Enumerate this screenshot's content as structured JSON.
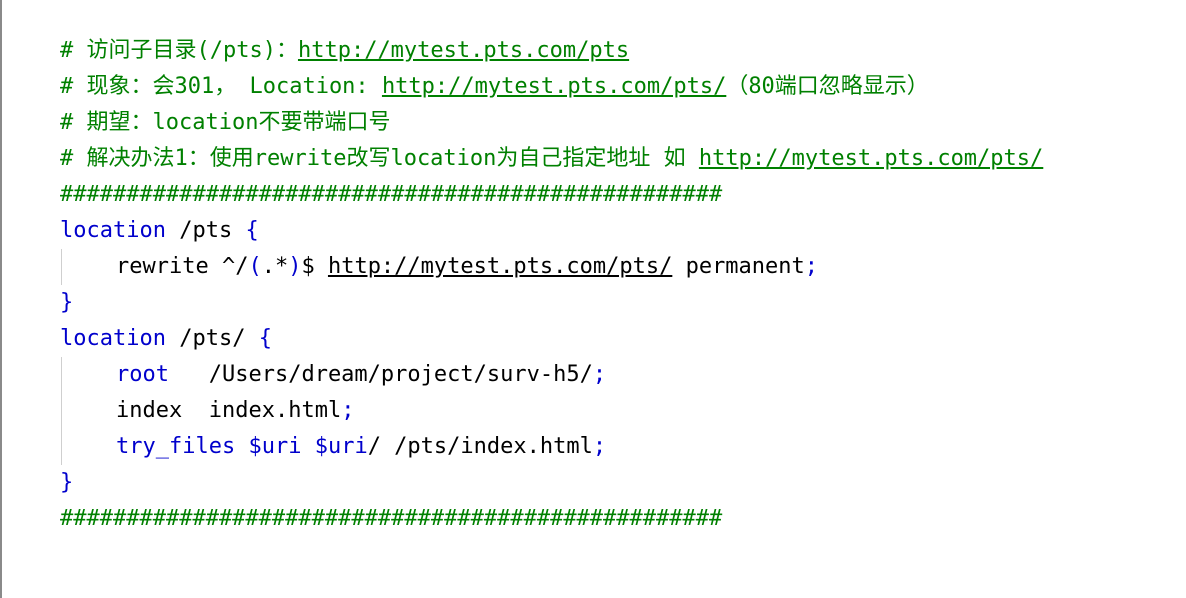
{
  "comments": {
    "line1": {
      "text": "# 访问子目录(/pts)：",
      "url": "http://mytest.pts.com/pts"
    },
    "line2": {
      "text": "# 现象：会301， Location: ",
      "url": "http://mytest.pts.com/pts/",
      "suffix": "（80端口忽略显示）"
    },
    "line3": {
      "text": "# 期望：location不要带端口号"
    },
    "line4": {
      "text": "# 解决办法1：使用rewrite改写location为自己指定地址 如 ",
      "url": "http://mytest.pts.com/pts/"
    }
  },
  "separator": "##################################################",
  "block1": {
    "keyword": "location",
    "path": " /pts ",
    "open": "{",
    "rewrite": {
      "directive": "rewrite ^/",
      "paren_open": "(",
      "regex": ".*",
      "paren_close": ")",
      "dollar": "$ ",
      "url": "http://mytest.pts.com/pts/",
      "flag": " permanent",
      "semi": ";"
    },
    "close": "}"
  },
  "block2": {
    "keyword": "location",
    "path": " /pts/ ",
    "open": "{",
    "root": {
      "directive": "root",
      "gap": "   ",
      "value": "/Users/dream/project/surv-h5/",
      "semi": ";"
    },
    "index": {
      "directive": "index",
      "gap": "  ",
      "value": "index.html",
      "semi": ";"
    },
    "try_files": {
      "directive": "try_files",
      "sp1": " ",
      "var1": "$uri",
      "sp2": " ",
      "var2": "$uri",
      "rest": "/ /pts/index.html",
      "semi": ";"
    },
    "close": "}"
  },
  "colors": {
    "comment": "#008000",
    "keyword": "#0000cc",
    "text": "#000000"
  }
}
